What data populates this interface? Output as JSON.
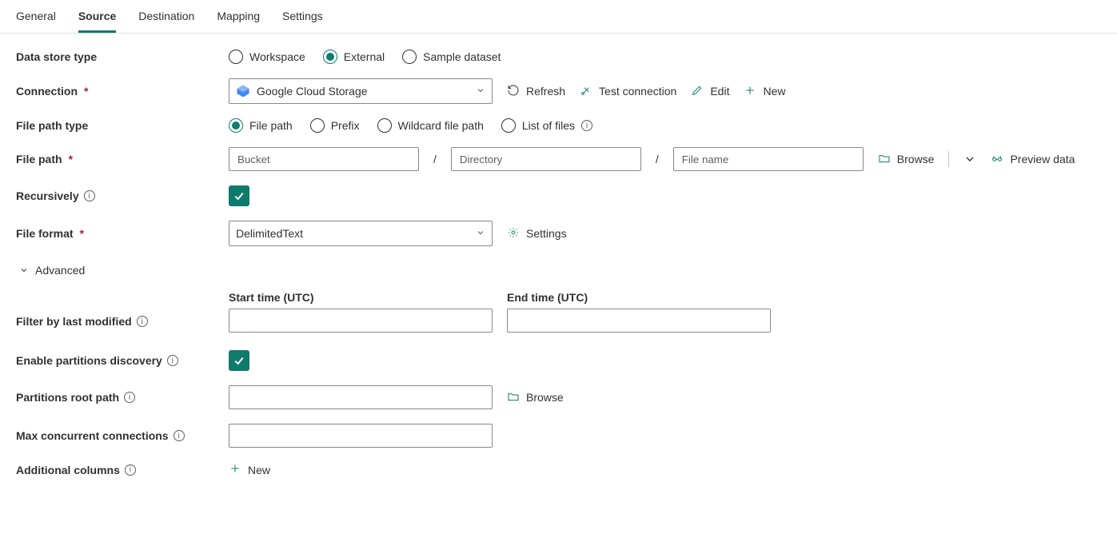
{
  "tabs": {
    "general": "General",
    "source": "Source",
    "destination": "Destination",
    "mapping": "Mapping",
    "settings": "Settings"
  },
  "labels": {
    "data_store_type": "Data store type",
    "connection": "Connection",
    "file_path_type": "File path type",
    "file_path": "File path",
    "recursively": "Recursively",
    "file_format": "File format",
    "advanced": "Advanced",
    "start_time": "Start time (UTC)",
    "end_time": "End time (UTC)",
    "filter_last_modified": "Filter by last modified",
    "enable_partitions": "Enable partitions discovery",
    "partitions_root": "Partitions root path",
    "max_concurrent": "Max concurrent connections",
    "additional_columns": "Additional columns"
  },
  "data_store_type": {
    "workspace": "Workspace",
    "external": "External",
    "sample": "Sample dataset"
  },
  "connection": {
    "value": "Google Cloud Storage",
    "refresh": "Refresh",
    "test": "Test connection",
    "edit": "Edit",
    "new": "New"
  },
  "file_path_type": {
    "file_path": "File path",
    "prefix": "Prefix",
    "wildcard": "Wildcard file path",
    "list": "List of files"
  },
  "file_path": {
    "bucket": "Bucket",
    "directory": "Directory",
    "file_name": "File name",
    "browse": "Browse",
    "preview": "Preview data"
  },
  "file_format": {
    "value": "DelimitedText",
    "settings": "Settings"
  },
  "partitions": {
    "browse": "Browse"
  },
  "additional_columns": {
    "new": "New"
  }
}
